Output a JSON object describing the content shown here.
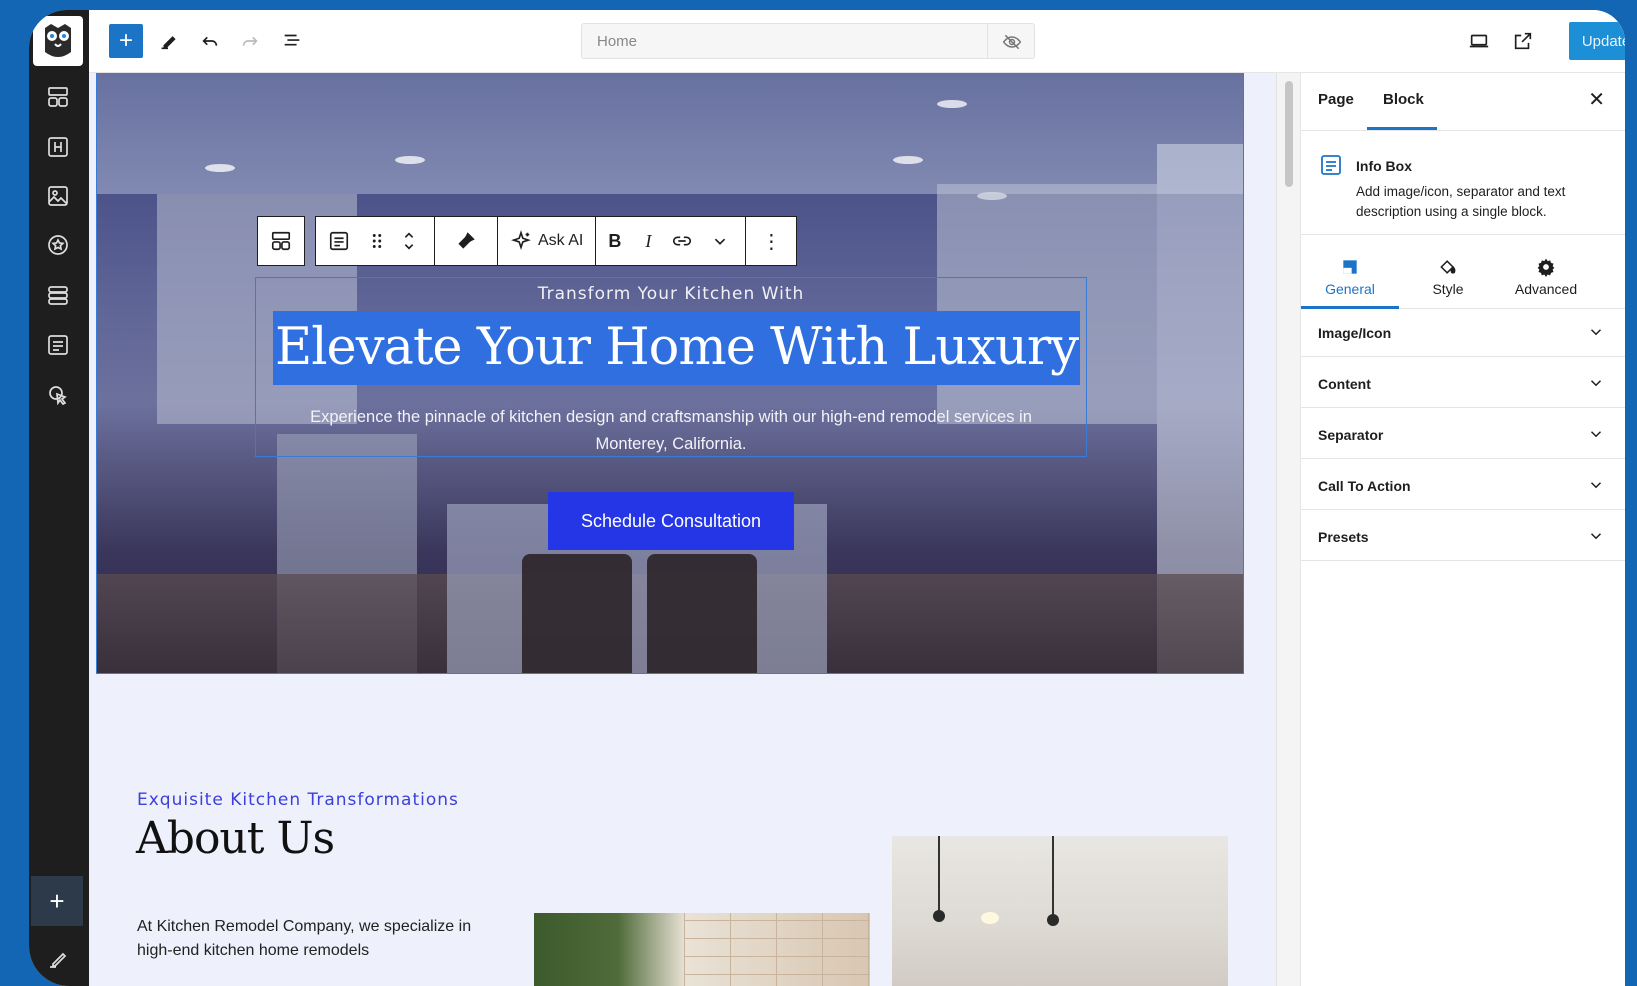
{
  "topbar": {
    "document_title": "Home",
    "update_label": "Update"
  },
  "hero": {
    "subtitle": "Transform Your Kitchen With",
    "title": "Elevate Your Home With Luxury",
    "description": "Experience the pinnacle of kitchen design and craftsmanship with our high-end remodel services in Monterey, California.",
    "cta_label": "Schedule Consultation"
  },
  "block_toolbar": {
    "ask_ai_label": "Ask AI",
    "bold_label": "B",
    "italic_label": "I"
  },
  "about": {
    "kicker": "Exquisite Kitchen Transformations",
    "title": "About Us",
    "body": "At Kitchen Remodel Company, we specialize in high-end kitchen home remodels"
  },
  "sidebar": {
    "tabs": [
      {
        "label": "Page"
      },
      {
        "label": "Block"
      }
    ],
    "block_name": "Info Box",
    "block_description": "Add image/icon, separator and text description using a single block.",
    "settings_tabs": [
      {
        "label": "General"
      },
      {
        "label": "Style"
      },
      {
        "label": "Advanced"
      }
    ],
    "panels": [
      {
        "label": "Image/Icon"
      },
      {
        "label": "Content"
      },
      {
        "label": "Separator"
      },
      {
        "label": "Call To Action"
      },
      {
        "label": "Presets"
      }
    ]
  },
  "colors": {
    "accent": "#1c74c7",
    "cta": "#2536e6",
    "selection": "#2f6fe0",
    "frame_bg": "#1266b3"
  }
}
